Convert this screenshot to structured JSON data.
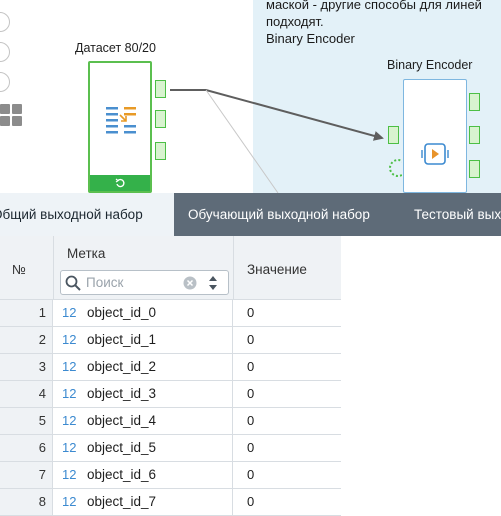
{
  "canvas": {
    "comment_lines": [
      "маской - другие способы для линей",
      "подходят.",
      "Binary Encoder"
    ],
    "nodes": {
      "dataset": {
        "title": "Датасет 80/20"
      },
      "binary_encoder": {
        "title": "Binary Encoder"
      }
    }
  },
  "tabs": [
    {
      "label": "Общий выходной набор",
      "active": true
    },
    {
      "label": "Обучающий выходной набор",
      "active": false
    },
    {
      "label": "Тестовый выходной набор",
      "active": false
    }
  ],
  "table": {
    "headers": {
      "number": "№",
      "label": "Метка",
      "value": "Значение"
    },
    "search_placeholder": "Поиск",
    "rows": [
      {
        "number": "1",
        "type": "12",
        "label": "object_id_0",
        "value": "0"
      },
      {
        "number": "2",
        "type": "12",
        "label": "object_id_1",
        "value": "0"
      },
      {
        "number": "3",
        "type": "12",
        "label": "object_id_2",
        "value": "0"
      },
      {
        "number": "4",
        "type": "12",
        "label": "object_id_3",
        "value": "0"
      },
      {
        "number": "5",
        "type": "12",
        "label": "object_id_4",
        "value": "0"
      },
      {
        "number": "6",
        "type": "12",
        "label": "object_id_5",
        "value": "0"
      },
      {
        "number": "7",
        "type": "12",
        "label": "object_id_6",
        "value": "0"
      },
      {
        "number": "8",
        "type": "12",
        "label": "object_id_7",
        "value": "0"
      }
    ]
  }
}
